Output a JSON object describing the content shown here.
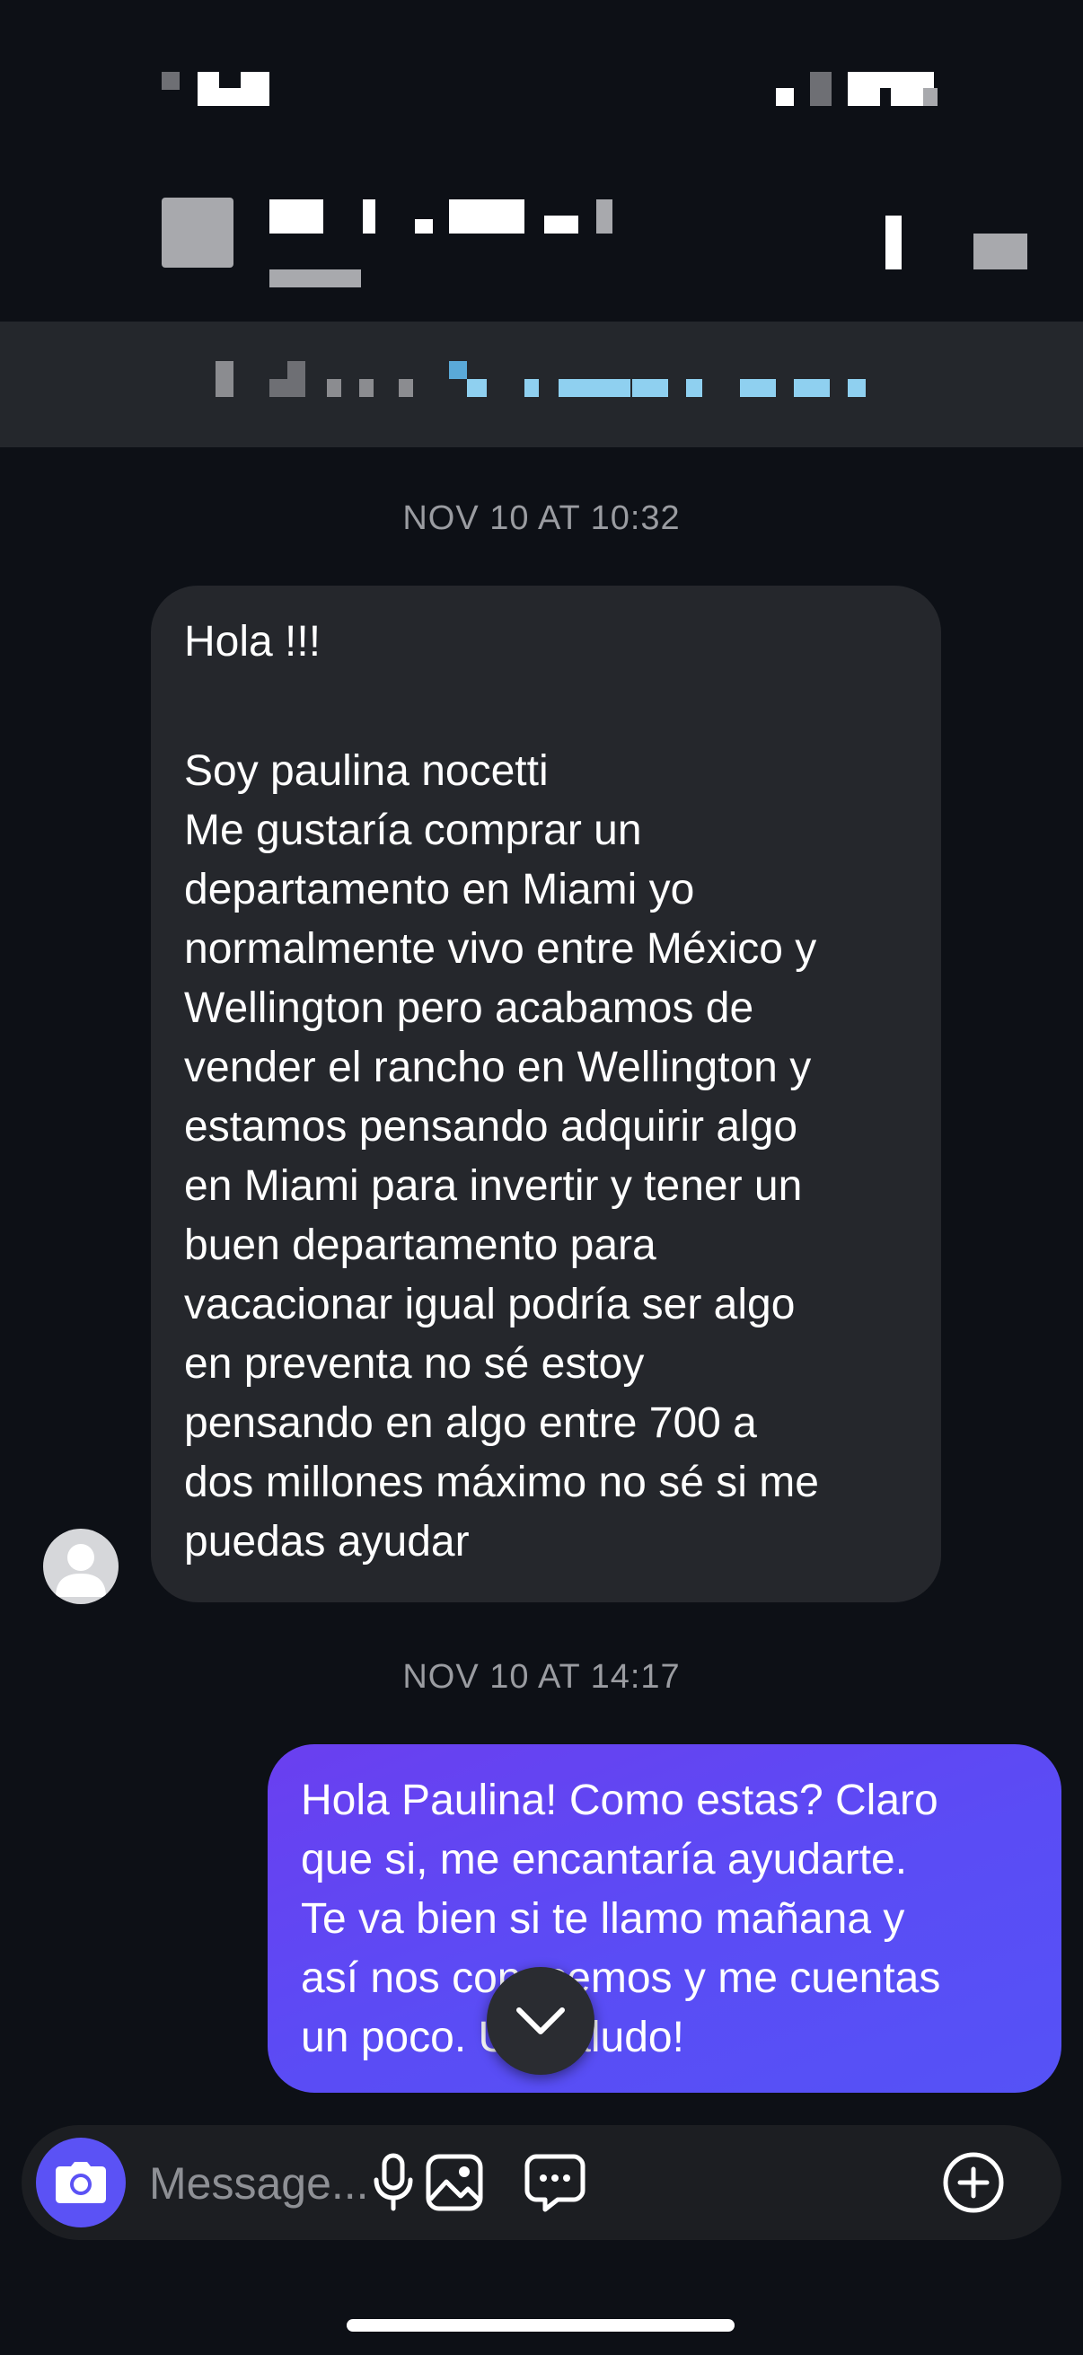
{
  "conversation": {
    "timestamp_first": "NOV 10 AT 10:32",
    "timestamp_second": "NOV 10 AT 14:17"
  },
  "incoming_message": {
    "lines": [
      "Hola !!!",
      "",
      "Soy paulina nocetti",
      "Me gustaría comprar un",
      "departamento en Miami yo",
      "normalmente vivo entre México y",
      "Wellington pero acabamos de",
      "vender el rancho en Wellington y",
      "estamos pensando adquirir algo",
      "en Miami para invertir y tener un",
      "buen departamento para",
      "vacacionar igual podría ser algo",
      "en preventa no sé estoy",
      "pensando en algo entre 700 a",
      "dos millones máximo no sé si me",
      "puedas ayudar"
    ]
  },
  "outgoing_message": {
    "lines": [
      "Hola Paulina! Como estas? Claro",
      "que si, me encantaría ayudarte.",
      "Te va bien si te llamo mañana y",
      "así nos conocemos y me cuentas",
      "un poco. Un saludo!"
    ]
  },
  "composer": {
    "placeholder": "Message..."
  },
  "icons": {
    "camera": "camera-icon",
    "microphone": "microphone-icon",
    "gallery": "image-icon",
    "sticker": "message-dots-icon",
    "more": "plus-circle-icon",
    "scroll": "chevron-down-icon"
  },
  "colors": {
    "background": "#0d1016",
    "incoming_bubble": "#25272c",
    "outgoing_bubble_start": "#6a3ff0",
    "outgoing_bubble_end": "#5552f6",
    "accent": "#5b52f5",
    "timestamp": "#9a9ca1"
  }
}
